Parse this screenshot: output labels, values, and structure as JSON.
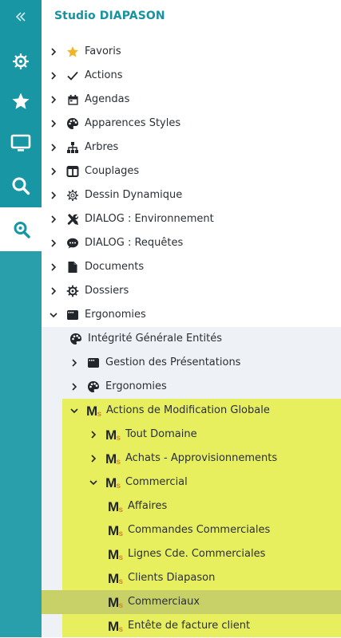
{
  "header": {
    "title": "Studio DIAPASON"
  },
  "rail": {
    "collapse_icon": "double-chevron-left",
    "items": [
      {
        "name": "helm-icon"
      },
      {
        "name": "star-icon"
      },
      {
        "name": "monitor-icon"
      },
      {
        "name": "search-icon"
      },
      {
        "name": "location-search-icon",
        "active": true
      }
    ]
  },
  "tree": [
    {
      "label": "Favoris",
      "icon": "star-icon",
      "expanded": false
    },
    {
      "label": "Actions",
      "icon": "check-icon",
      "expanded": false
    },
    {
      "label": "Agendas",
      "icon": "calendar-icon",
      "expanded": false
    },
    {
      "label": "Apparences Styles",
      "icon": "palette-icon",
      "expanded": false
    },
    {
      "label": "Arbres",
      "icon": "sitemap-icon",
      "expanded": false
    },
    {
      "label": "Couplages",
      "icon": "columns-icon",
      "expanded": false
    },
    {
      "label": "Dessin Dynamique",
      "icon": "gear-outline-icon",
      "expanded": false
    },
    {
      "label": "DIALOG : Environnement",
      "icon": "tools-icon",
      "expanded": false
    },
    {
      "label": "DIALOG : Requêtes",
      "icon": "chat-icon",
      "expanded": false
    },
    {
      "label": "Documents",
      "icon": "document-icon",
      "expanded": false
    },
    {
      "label": "Dossiers",
      "icon": "helm-icon",
      "expanded": false
    },
    {
      "label": "Ergonomies",
      "icon": "window-icon",
      "expanded": true
    },
    {
      "label": "Intégrité Générale Entités",
      "icon": "palette-icon",
      "expanded": null
    },
    {
      "label": "Gestion des Présentations",
      "icon": "window-icon",
      "expanded": false
    },
    {
      "label": "Ergonomies",
      "icon": "palette-icon",
      "expanded": false
    },
    {
      "label": "Actions de Modification Globale",
      "icon": "ms-icon",
      "expanded": true
    },
    {
      "label": "Tout Domaine",
      "icon": "ms-icon",
      "expanded": false
    },
    {
      "label": "Achats - Approvisionnements",
      "icon": "ms-icon",
      "expanded": false
    },
    {
      "label": "Commercial",
      "icon": "ms-icon",
      "expanded": true
    },
    {
      "label": "Affaires",
      "icon": "ms-icon",
      "expanded": null
    },
    {
      "label": "Commandes Commerciales",
      "icon": "ms-icon",
      "expanded": null
    },
    {
      "label": "Lignes Cde. Commerciales",
      "icon": "ms-icon",
      "expanded": null
    },
    {
      "label": "Clients Diapason",
      "icon": "ms-icon",
      "expanded": null
    },
    {
      "label": "Commerciaux",
      "icon": "ms-icon",
      "expanded": null,
      "selected": true
    },
    {
      "label": "Entête de facture client",
      "icon": "ms-icon",
      "expanded": null
    }
  ],
  "colors": {
    "rail": "#1896a4",
    "title": "#1891a0",
    "highlight": "#e8ef5e",
    "selected": "#c8d168",
    "subpanel": "#eef1f5",
    "star": "#f4b324"
  }
}
